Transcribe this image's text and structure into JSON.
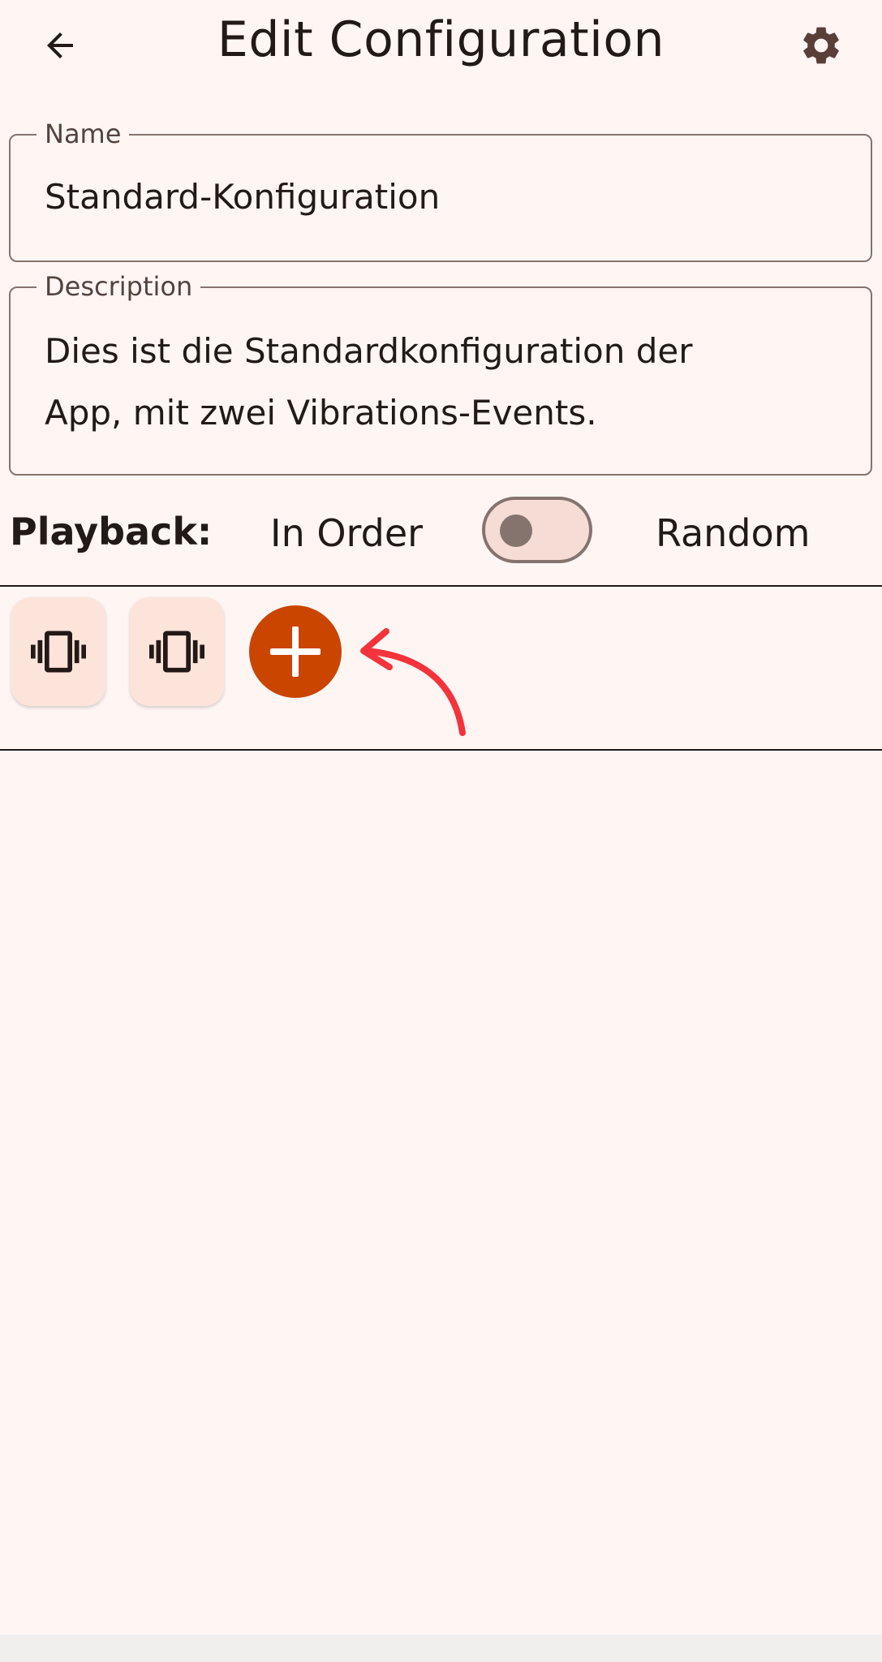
{
  "header": {
    "title": "Edit Configuration",
    "back_icon": "arrow-back-icon",
    "settings_icon": "gear-icon"
  },
  "form": {
    "name": {
      "label": "Name",
      "value": "Standard-Konfiguration"
    },
    "description": {
      "label": "Description",
      "value_line1": "Dies ist die Standardkonfiguration der",
      "value_line2": "App, mit zwei Vibrations-Events."
    }
  },
  "playback": {
    "label": "Playback:",
    "option_left": "In Order",
    "option_right": "Random",
    "toggle_on": false
  },
  "events": {
    "items": [
      {
        "icon": "vibration-icon"
      },
      {
        "icon": "vibration-icon"
      }
    ],
    "add_icon": "plus-icon"
  },
  "colors": {
    "background": "#fff6f4",
    "accent": "#c94500",
    "chip": "#fde4da",
    "annotation": "#f4333c"
  }
}
